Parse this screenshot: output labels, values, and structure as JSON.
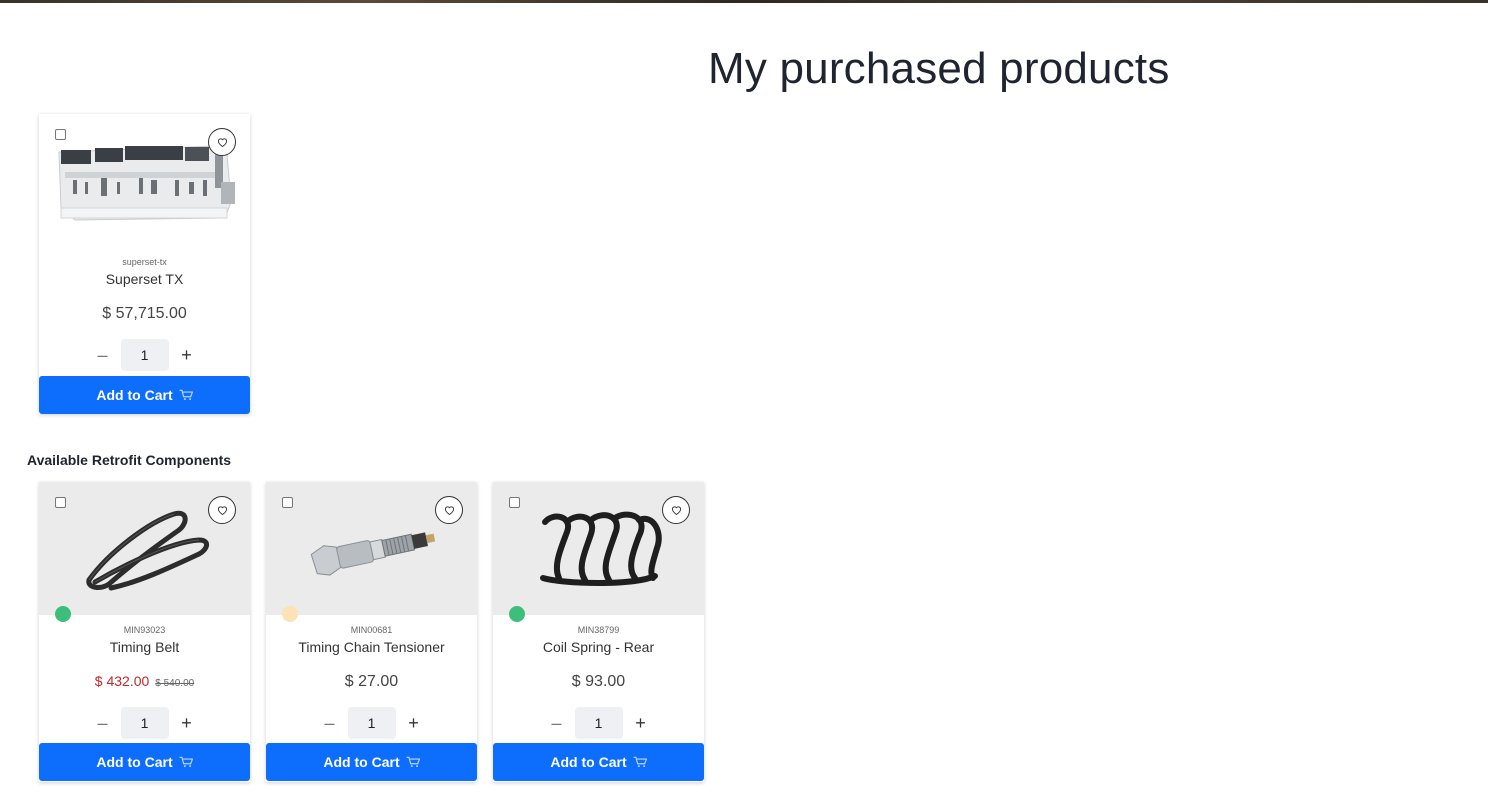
{
  "page": {
    "title": "My purchased products"
  },
  "section": {
    "title": "Available Retrofit Components"
  },
  "colors": {
    "accent": "#0d6efd",
    "sale": "#c0282b",
    "stock_green": "#3dbe7a",
    "stock_amber": "#fde2b5"
  },
  "purchased": [
    {
      "sku": "superset-tx",
      "name": "Superset TX",
      "price": "$ 57,715.00",
      "qty": "1",
      "cart_label": "Add to Cart",
      "image_icon": "edge-machine-image"
    }
  ],
  "components": [
    {
      "sku": "MIN93023",
      "name": "Timing Belt",
      "sale_price": "$ 432.00",
      "old_price": "$ 540.00",
      "qty": "1",
      "cart_label": "Add to Cart",
      "stock_color": "#3dbe7a",
      "image_icon": "timing-belt-image"
    },
    {
      "sku": "MIN00681",
      "name": "Timing Chain Tensioner",
      "price": "$ 27.00",
      "qty": "1",
      "cart_label": "Add to Cart",
      "stock_color": "#fde2b5",
      "image_icon": "tensioner-image"
    },
    {
      "sku": "MIN38799",
      "name": "Coil Spring - Rear",
      "price": "$ 93.00",
      "qty": "1",
      "cart_label": "Add to Cart",
      "stock_color": "#3dbe7a",
      "image_icon": "coil-spring-image"
    }
  ],
  "controls": {
    "minus": "–",
    "plus": "+"
  }
}
